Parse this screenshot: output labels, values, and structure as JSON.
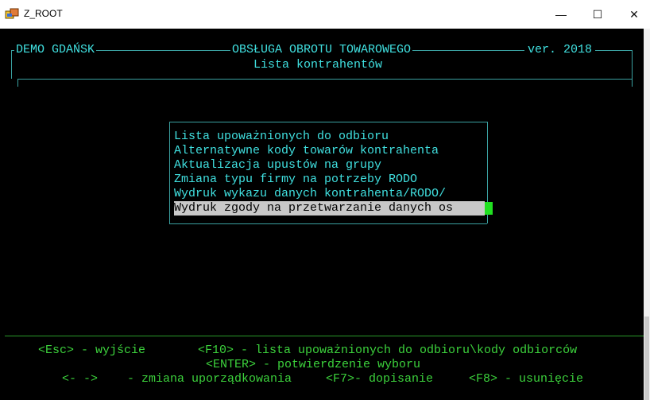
{
  "window": {
    "title": "Z_ROOT",
    "minimize": "—",
    "maximize": "☐",
    "close": "✕"
  },
  "header": {
    "company": "DEMO GDAŃSK",
    "module": "OBSŁUGA OBROTU TOWAROWEGO",
    "version": "ver. 2018",
    "screen_title": "Lista kontrahentów"
  },
  "menu": {
    "items": [
      "Lista upoważnionych do odbioru",
      "Alternatywne kody towarów kontrahenta",
      "Aktualizacja upustów na grupy",
      "Zmiana typu firmy na potrzeby RODO",
      "Wydruk wykazu danych kontrahenta/RODO/",
      "Wydruk zgody na przetwarzanie danych os"
    ],
    "selected_index": 5
  },
  "footer": {
    "line1_a": "<Esc> - wyjście",
    "line1_b": "<F10> - lista upoważnionych do odbioru\\kody odbiorców",
    "line2": "<ENTER> - potwierdzenie wyboru",
    "line3_a": "<- ->",
    "line3_b": "- zmiana uporządkowania",
    "line3_c": "<F7>- dopisanie",
    "line3_d": "<F8> - usunięcie"
  },
  "colors": {
    "console_bg": "#000000",
    "text": "#40e0e0",
    "footer_text": "#3cd23c",
    "selection_bg": "#c8c8c8",
    "cursor": "#20e020"
  }
}
